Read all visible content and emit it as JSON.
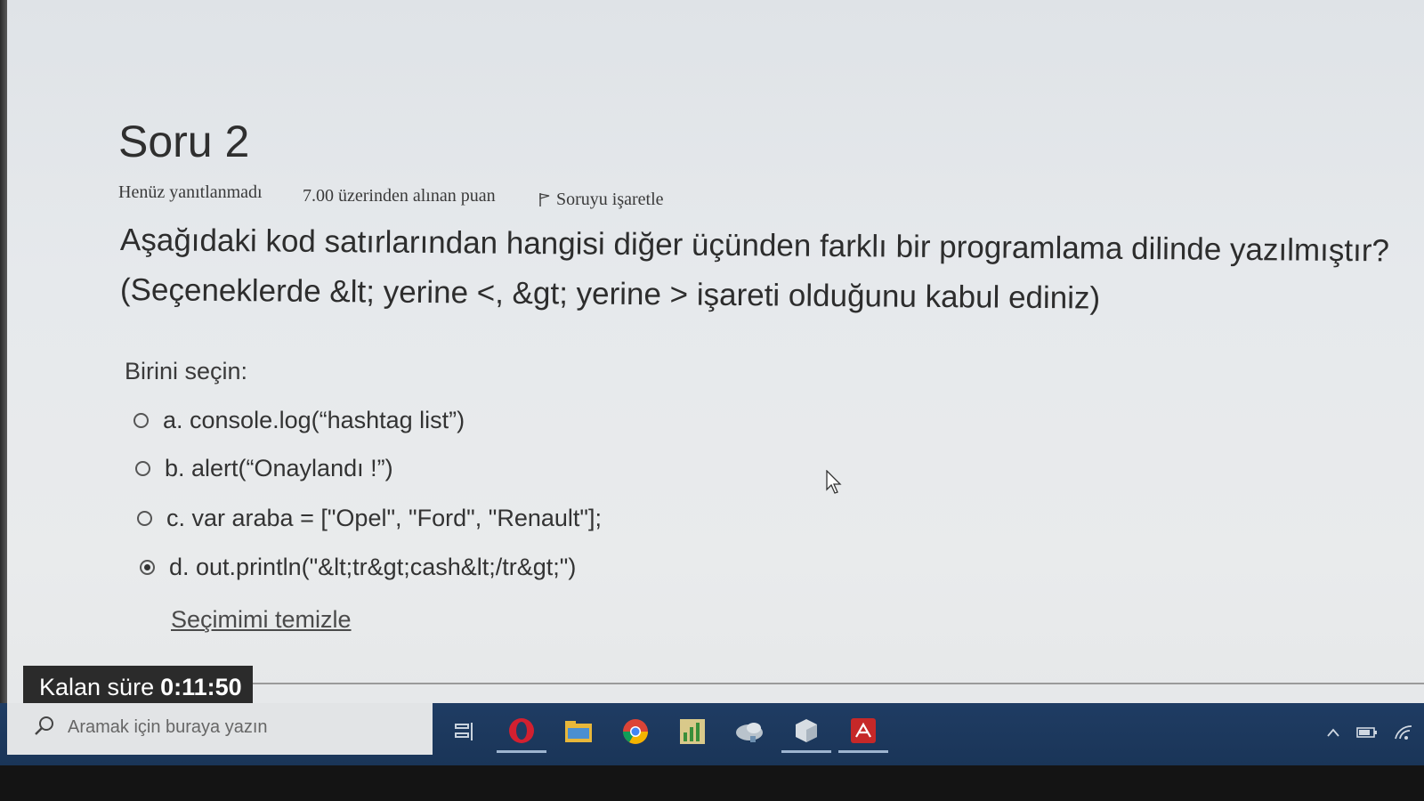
{
  "question": {
    "title": "Soru 2",
    "status": "Henüz yanıtlanmadı",
    "points": "7.00 üzerinden alınan puan",
    "flag_label": "Soruyu işaretle",
    "text_line1": "Aşağıdaki kod satırlarından hangisi diğer üçünden farklı bir programlama dilinde yazılmıştır?",
    "text_line2": "(Seçeneklerde &lt; yerine <, &gt; yerine > işareti olduğunu kabul ediniz)"
  },
  "answer": {
    "prompt": "Birini seçin:",
    "options": [
      {
        "label": "a. console.log(“hashtag list”)",
        "selected": false
      },
      {
        "label": "b. alert(“Onaylandı !”)",
        "selected": false
      },
      {
        "label": "c. var araba = [\"Opel\", \"Ford\", \"Renault\"];",
        "selected": false
      },
      {
        "label": "d. out.println(\"&lt;tr&gt;cash&lt;/tr&gt;\")",
        "selected": true
      }
    ],
    "clear_label": "Seçimimi temizle"
  },
  "timer": {
    "label": "Kalan süre",
    "value": "0:11:50"
  },
  "taskbar": {
    "search_placeholder": "Aramak için buraya yazın",
    "icons": [
      "task-view-icon",
      "opera-icon",
      "file-explorer-icon",
      "chrome-icon",
      "chart-app-icon",
      "cloud-app-icon",
      "cube-app-icon",
      "acrobat-icon"
    ]
  },
  "colors": {
    "taskbar": "#1f3c63",
    "timer_bg": "#2b2b2b",
    "page_bg": "#e6e9ec"
  }
}
